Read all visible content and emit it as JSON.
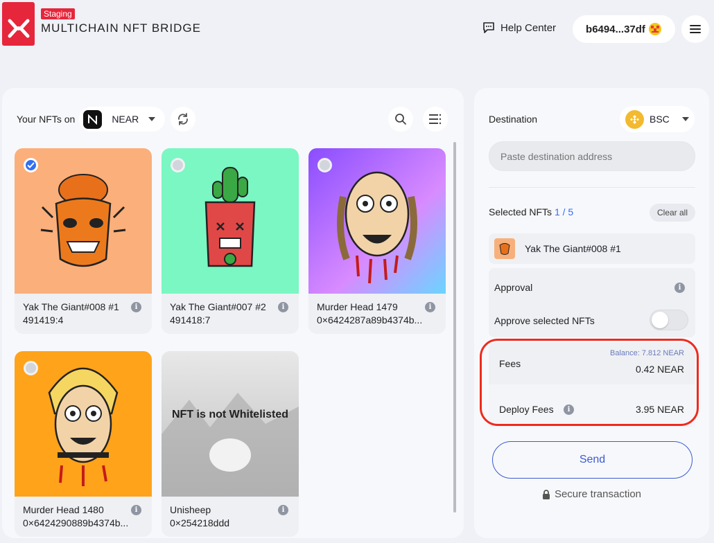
{
  "header": {
    "staging_badge": "Staging",
    "title": "MULTICHAIN NFT BRIDGE",
    "help_center": "Help Center",
    "wallet_address": "b6494...37df"
  },
  "left_panel": {
    "your_nfts_label": "Your NFTs on",
    "chain": "NEAR",
    "nfts": [
      {
        "name": "Yak The Giant#008 #1",
        "id": "491419:4",
        "selected": true,
        "chain_icon": "near-icon",
        "bg": "#fbaf7a"
      },
      {
        "name": "Yak The Giant#007 #2",
        "id": "491418:7",
        "selected": false,
        "chain_icon": "near-icon",
        "bg": "#7af7c2"
      },
      {
        "name": "Murder Head 1479",
        "id": "0×6424287a89b4374b...",
        "selected": false,
        "chain_icon": "polygon-icon",
        "bg": "#c77dff"
      },
      {
        "name": "Murder Head 1480",
        "id": "0×6424290889b4374b...",
        "selected": false,
        "chain_icon": "polygon-icon",
        "bg": "#ffa31a"
      },
      {
        "name": "Unisheep",
        "id": "0×254218ddd",
        "selected": false,
        "chain_icon": "near-icon",
        "bg": "#d9d9d9",
        "overlay": "NFT is not Whitelisted"
      }
    ]
  },
  "right_panel": {
    "destination_label": "Destination",
    "destination_chain": "BSC",
    "address_placeholder": "Paste destination address",
    "selected_label": "Selected NFTs",
    "selected_count": "1 / 5",
    "clear_all": "Clear all",
    "selected_item": "Yak The Giant#008 #1",
    "approval_title": "Approval",
    "approve_label": "Approve selected NFTs",
    "approve_on": false,
    "fees_label": "Fees",
    "balance": "Balance: 7.812 NEAR",
    "fees_value": "0.42 NEAR",
    "deploy_fees_label": "Deploy Fees",
    "deploy_fees_value": "3.95 NEAR",
    "send_label": "Send",
    "secure_label": "Secure transaction"
  },
  "colors": {
    "brand_red": "#e6263b",
    "accent_blue": "#3270f0",
    "send_blue": "#3b5bd1",
    "highlight_red": "#ef2a1d"
  }
}
